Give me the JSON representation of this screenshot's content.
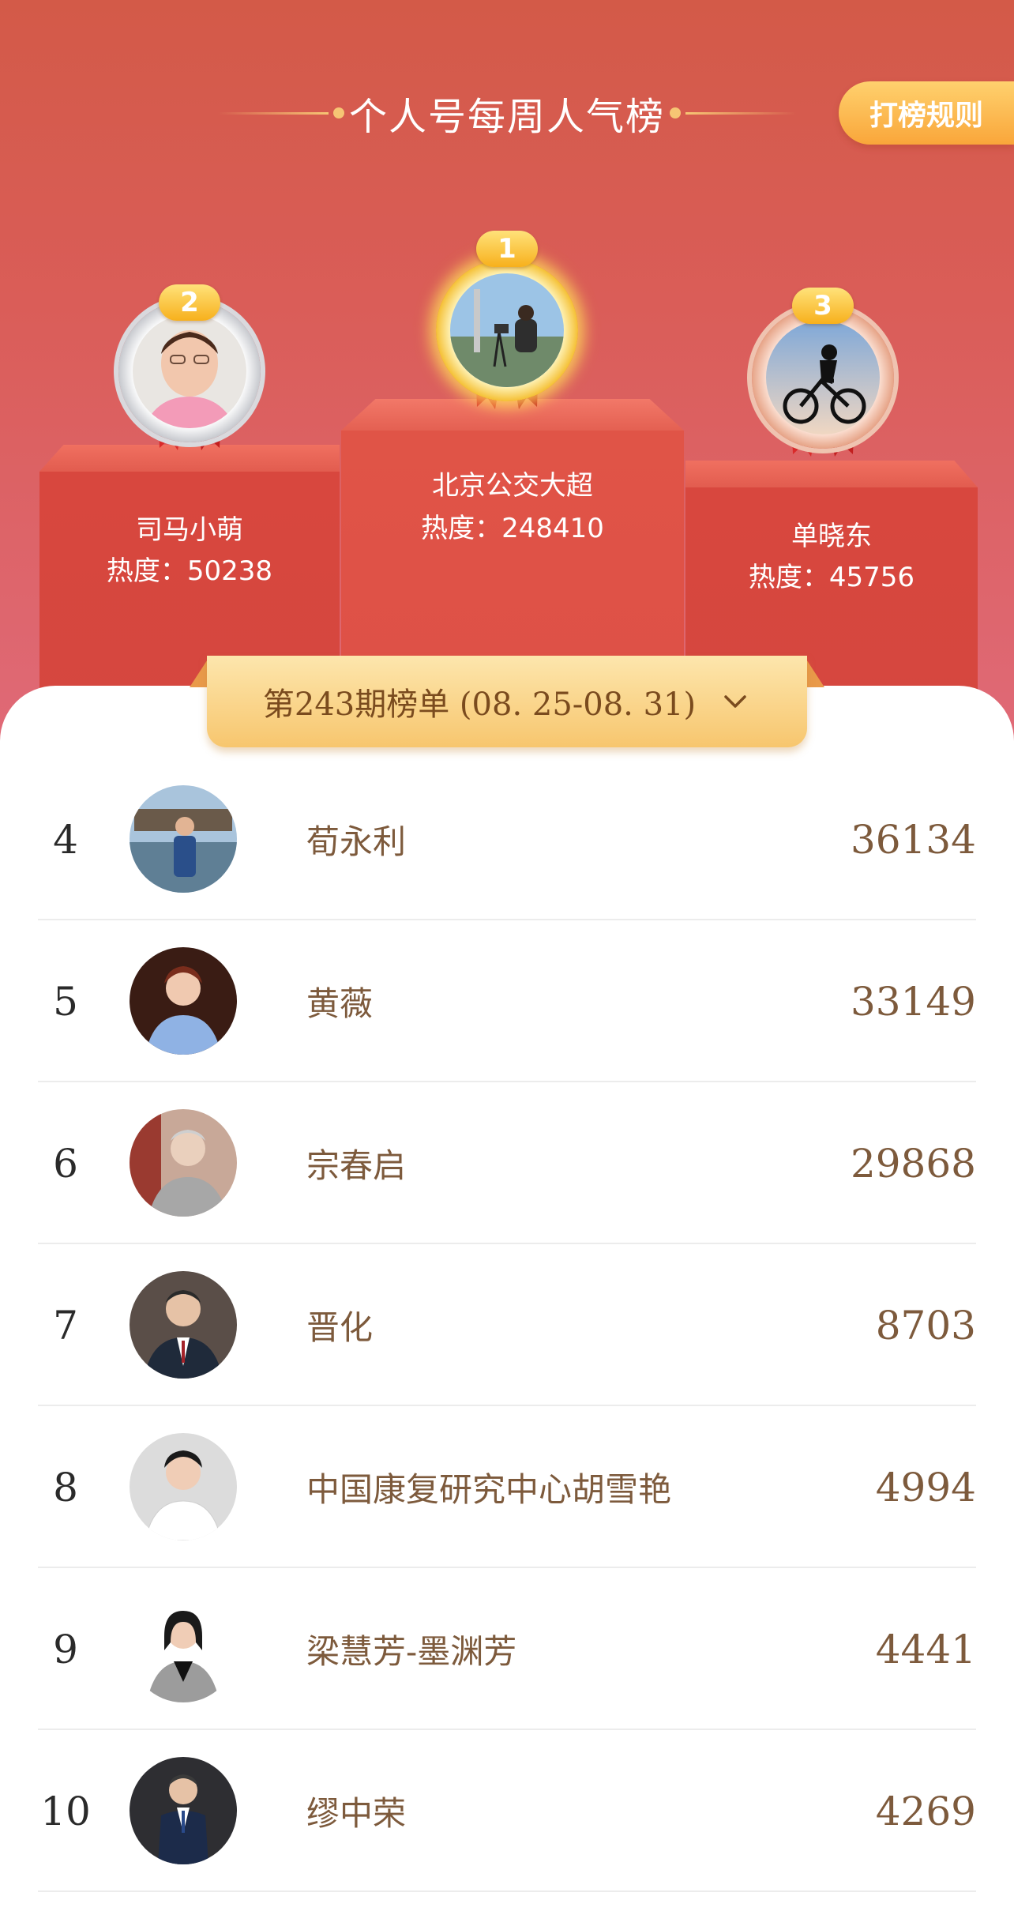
{
  "header": {
    "title": "个人号每周人气榜",
    "rules_button": "打榜规则"
  },
  "podium": {
    "first": {
      "rank": "1",
      "name": "北京公交大超",
      "heat": "热度：248410"
    },
    "second": {
      "rank": "2",
      "name": "司马小萌",
      "heat": "热度：50238"
    },
    "third": {
      "rank": "3",
      "name": "单晓东",
      "heat": "热度：45756"
    }
  },
  "period": {
    "label": "第243期榜单 (08. 25-08. 31)"
  },
  "list": [
    {
      "rank": "4",
      "name": "荀永利",
      "score": "36134"
    },
    {
      "rank": "5",
      "name": "黄薇",
      "score": "33149"
    },
    {
      "rank": "6",
      "name": "宗春启",
      "score": "29868"
    },
    {
      "rank": "7",
      "name": "晋化",
      "score": "8703"
    },
    {
      "rank": "8",
      "name": "中国康复研究中心胡雪艳",
      "score": "4994"
    },
    {
      "rank": "9",
      "name": "梁慧芳-墨渊芳",
      "score": "4441"
    },
    {
      "rank": "10",
      "name": "缪中荣",
      "score": "4269"
    }
  ],
  "colors": {
    "accent_gold": "#f7b01c",
    "text_brown": "#7d5a3c",
    "hero_red": "#d35a48"
  }
}
